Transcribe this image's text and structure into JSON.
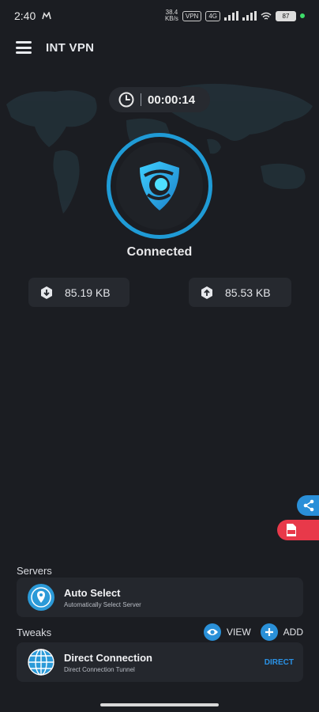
{
  "status_bar": {
    "time": "2:40",
    "net_speed_top": "38.4",
    "net_speed_bottom": "KB/s",
    "vpn_badge": "VPN",
    "sim_badge": "4G",
    "battery": "87"
  },
  "app": {
    "title": "INT VPN"
  },
  "connection": {
    "duration": "00:00:14",
    "status": "Connected",
    "download": "85.19 KB",
    "upload": "85.53 KB"
  },
  "servers": {
    "section_label": "Servers",
    "selected": {
      "title": "Auto Select",
      "subtitle": "Automatically Select Server"
    }
  },
  "tweaks": {
    "section_label": "Tweaks",
    "view_label": "VIEW",
    "add_label": "ADD",
    "selected": {
      "title": "Direct Connection",
      "subtitle": "Direct Connection Tunnel",
      "tag": "DIRECT"
    }
  },
  "colors": {
    "accent": "#1f9bd6",
    "pdf": "#e8394a",
    "background": "#1b1d22"
  },
  "icons": [
    "menu-icon",
    "clock-icon",
    "shield-logo-icon",
    "download-icon",
    "upload-icon",
    "share-icon",
    "pdf-icon",
    "location-pin-icon",
    "globe-icon",
    "eye-icon",
    "plus-icon"
  ]
}
